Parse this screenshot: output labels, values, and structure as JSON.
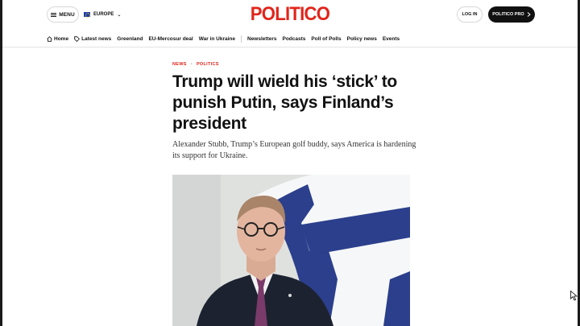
{
  "header": {
    "menu_label": "MENU",
    "region_label": "EUROPE",
    "logo_text": "POLITICO",
    "login_label": "LOG IN",
    "pro_label": "POLITICO PRO"
  },
  "nav": {
    "items": [
      {
        "label": "Home",
        "icon": "home-icon"
      },
      {
        "label": "Latest news",
        "icon": "tag-icon"
      },
      {
        "label": "Greenland"
      },
      {
        "label": "EU-Mercosur deal"
      },
      {
        "label": "War in Ukraine"
      },
      {
        "label": "Newsletters"
      },
      {
        "label": "Podcasts"
      },
      {
        "label": "Poll of Polls"
      },
      {
        "label": "Policy news"
      },
      {
        "label": "Events"
      }
    ]
  },
  "article": {
    "breadcrumbs": [
      "NEWS",
      "POLITICS"
    ],
    "headline": "Trump will wield his ‘stick’ to punish Putin, says Finland’s president",
    "dek": "Alexander Stubb, Trump’s European golf buddy, says America is hardening its support for Ukraine."
  },
  "colors": {
    "brand_red": "#e1251b",
    "text": "#111111",
    "pro_button_bg": "#111111"
  }
}
